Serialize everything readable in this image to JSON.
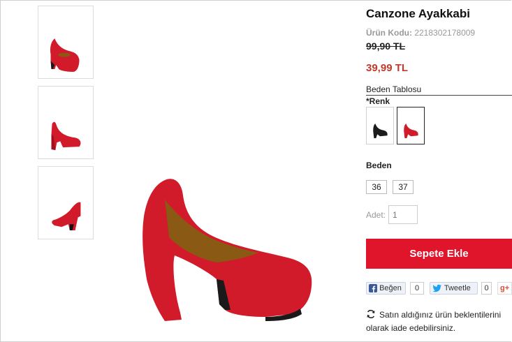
{
  "product": {
    "title": "Canzone Ayakkabi",
    "code_label": "Ürün Kodu:",
    "code_value": "2218302178009",
    "old_price": "99,90 TL",
    "price": "39,99 TL",
    "size_table_link": "Beden Tablosu",
    "color_label": "*Renk",
    "colors": [
      {
        "name": "black",
        "hex": "#1b1b1b",
        "selected": false
      },
      {
        "name": "red",
        "hex": "#d11a2a",
        "selected": true
      }
    ],
    "size_label": "Beden",
    "sizes": [
      "36",
      "37"
    ],
    "quantity_label": "Adet:",
    "quantity_placeholder": "1",
    "add_to_cart": "Sepete Ekle",
    "brand_color": "#e0142b"
  },
  "social": {
    "facebook_label": "Beğen",
    "facebook_count": "0",
    "twitter_label": "Tweetle",
    "twitter_count": "0",
    "gplus_label": "g+"
  },
  "return_policy": {
    "line1": "Satın aldığınız ürün beklentilerini",
    "line2": "olarak iade edebilirsiniz."
  },
  "icons": [
    "shoe-thumbnail",
    "facebook-icon",
    "twitter-icon",
    "refresh-icon"
  ]
}
